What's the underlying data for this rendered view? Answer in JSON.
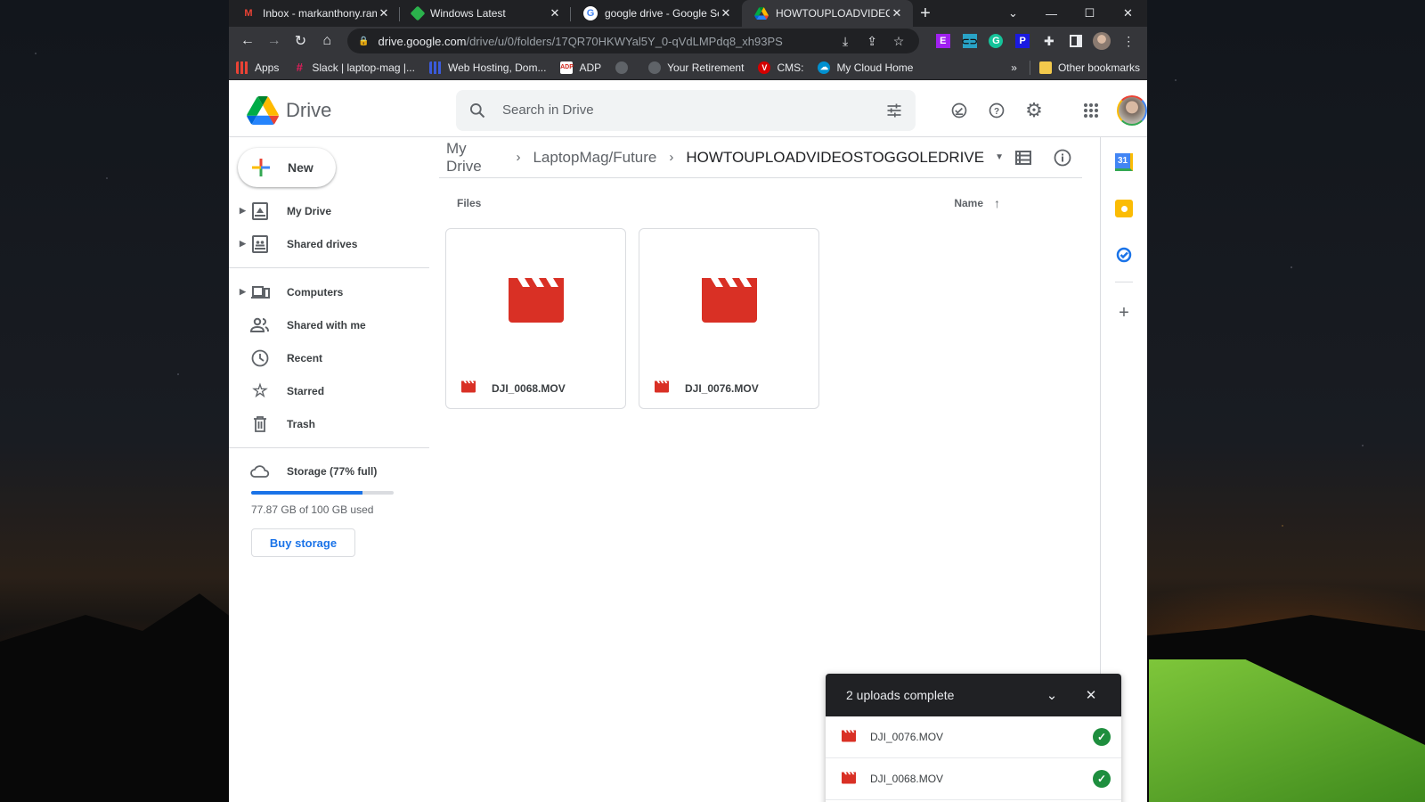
{
  "browser": {
    "tabs": [
      {
        "title": "Inbox - markanthony.ramirez",
        "icon": "gmail-icon",
        "active": false
      },
      {
        "title": "Windows Latest",
        "icon": "windows-latest-icon",
        "active": false
      },
      {
        "title": "google drive - Google Search",
        "icon": "google-icon",
        "active": false
      },
      {
        "title": "HOWTOUPLOADVIDEOSTOGGOLEDRIVE",
        "icon": "drive-icon",
        "active": true
      }
    ],
    "new_tab_label": "+",
    "address": {
      "host": "drive.google.com",
      "path": "/drive/u/0/folders/17QR70HKWYal5Y_0-qVdLMPdq8_xh93PS"
    },
    "extensions": [
      {
        "name": "extension-e-icon",
        "glyph": "E",
        "color": "#a020f0"
      },
      {
        "name": "extension-link-icon",
        "glyph": "⛓",
        "color": "#29a3c6"
      },
      {
        "name": "grammarly-icon",
        "glyph": "G",
        "color": "#15c39a"
      },
      {
        "name": "extension-p-icon",
        "glyph": "P",
        "color": "#1a1ae0"
      }
    ],
    "bookmarks": [
      {
        "label": "Apps",
        "icon": "apps-grid-icon",
        "color": "#4285f4"
      },
      {
        "label": "Slack | laptop-mag |...",
        "icon": "slack-icon",
        "color": "#e01e5a"
      },
      {
        "label": "Web Hosting, Dom...",
        "icon": "web-hosting-icon",
        "color": "#3b5bdb"
      },
      {
        "label": "ADP",
        "icon": "adp-icon",
        "color": "#d0271d"
      },
      {
        "label": "",
        "icon": "globe-icon",
        "color": "#5f6368"
      },
      {
        "label": "Your Retirement",
        "icon": "globe-icon",
        "color": "#5f6368"
      },
      {
        "label": "CMS:",
        "icon": "cms-v-icon",
        "color": "#d50000"
      },
      {
        "label": "My Cloud Home",
        "icon": "cloud-home-icon",
        "color": "#0090d0"
      }
    ],
    "overflow_label": "»",
    "other_bookmarks": "Other bookmarks"
  },
  "drive": {
    "app_name": "Drive",
    "search_placeholder": "Search in Drive",
    "new_button": "New",
    "nav": [
      {
        "label": "My Drive",
        "icon": "my-drive-icon",
        "expandable": true
      },
      {
        "label": "Shared drives",
        "icon": "shared-drives-icon",
        "expandable": true
      }
    ],
    "nav2": [
      {
        "label": "Computers",
        "icon": "computers-icon",
        "expandable": true
      },
      {
        "label": "Shared with me",
        "icon": "shared-with-me-icon",
        "expandable": false
      },
      {
        "label": "Recent",
        "icon": "clock-icon",
        "expandable": false
      },
      {
        "label": "Starred",
        "icon": "star-icon",
        "expandable": false
      },
      {
        "label": "Trash",
        "icon": "trash-icon",
        "expandable": false
      }
    ],
    "storage": {
      "label": "Storage (77% full)",
      "used_text": "77.87 GB of 100 GB used",
      "percent": 77.87,
      "buy_label": "Buy storage"
    },
    "breadcrumb": [
      "My Drive",
      "LaptopMag/Future",
      "HOWTOUPLOADVIDEOSTOGGOLEDRIVE"
    ],
    "section_label": "Files",
    "sort_label": "Name",
    "files": [
      {
        "name": "DJI_0068.MOV",
        "type": "video"
      },
      {
        "name": "DJI_0076.MOV",
        "type": "video"
      }
    ],
    "upload_panel": {
      "title": "2 uploads complete",
      "items": [
        {
          "name": "DJI_0076.MOV",
          "status": "complete"
        },
        {
          "name": "DJI_0068.MOV",
          "status": "complete"
        }
      ]
    },
    "colors": {
      "accent": "#1a73e8",
      "video_red": "#d93025",
      "success": "#1e8e3e"
    }
  }
}
